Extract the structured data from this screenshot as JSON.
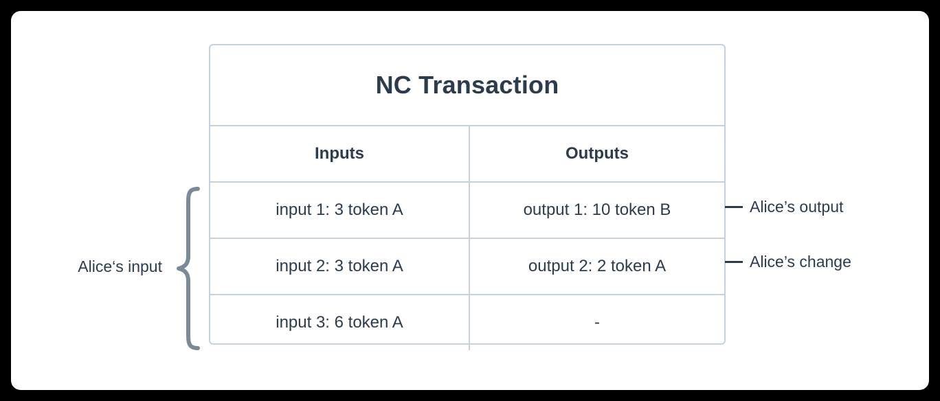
{
  "diagram": {
    "title": "NC Transaction",
    "table": {
      "headers": [
        "Inputs",
        "Outputs"
      ],
      "rows": [
        {
          "input": "input 1: 3 token A",
          "output": "output 1: 10 token B"
        },
        {
          "input": "input 2: 3 token A",
          "output": "output 2: 2 token A"
        },
        {
          "input": "input 3: 6 token A",
          "output": "-"
        }
      ]
    },
    "annotations": {
      "left": {
        "label": "Alice‘s input",
        "marker": "curly-brace"
      },
      "right": [
        {
          "label": "Alice’s output",
          "marker": "dash"
        },
        {
          "label": "Alice’s change",
          "marker": "dash"
        }
      ]
    },
    "colors": {
      "border": "#c5d2dd",
      "text": "#2d3c4d",
      "brace": "#7a8a99",
      "card_background": "#ffffff",
      "page_background": "#000000"
    }
  }
}
